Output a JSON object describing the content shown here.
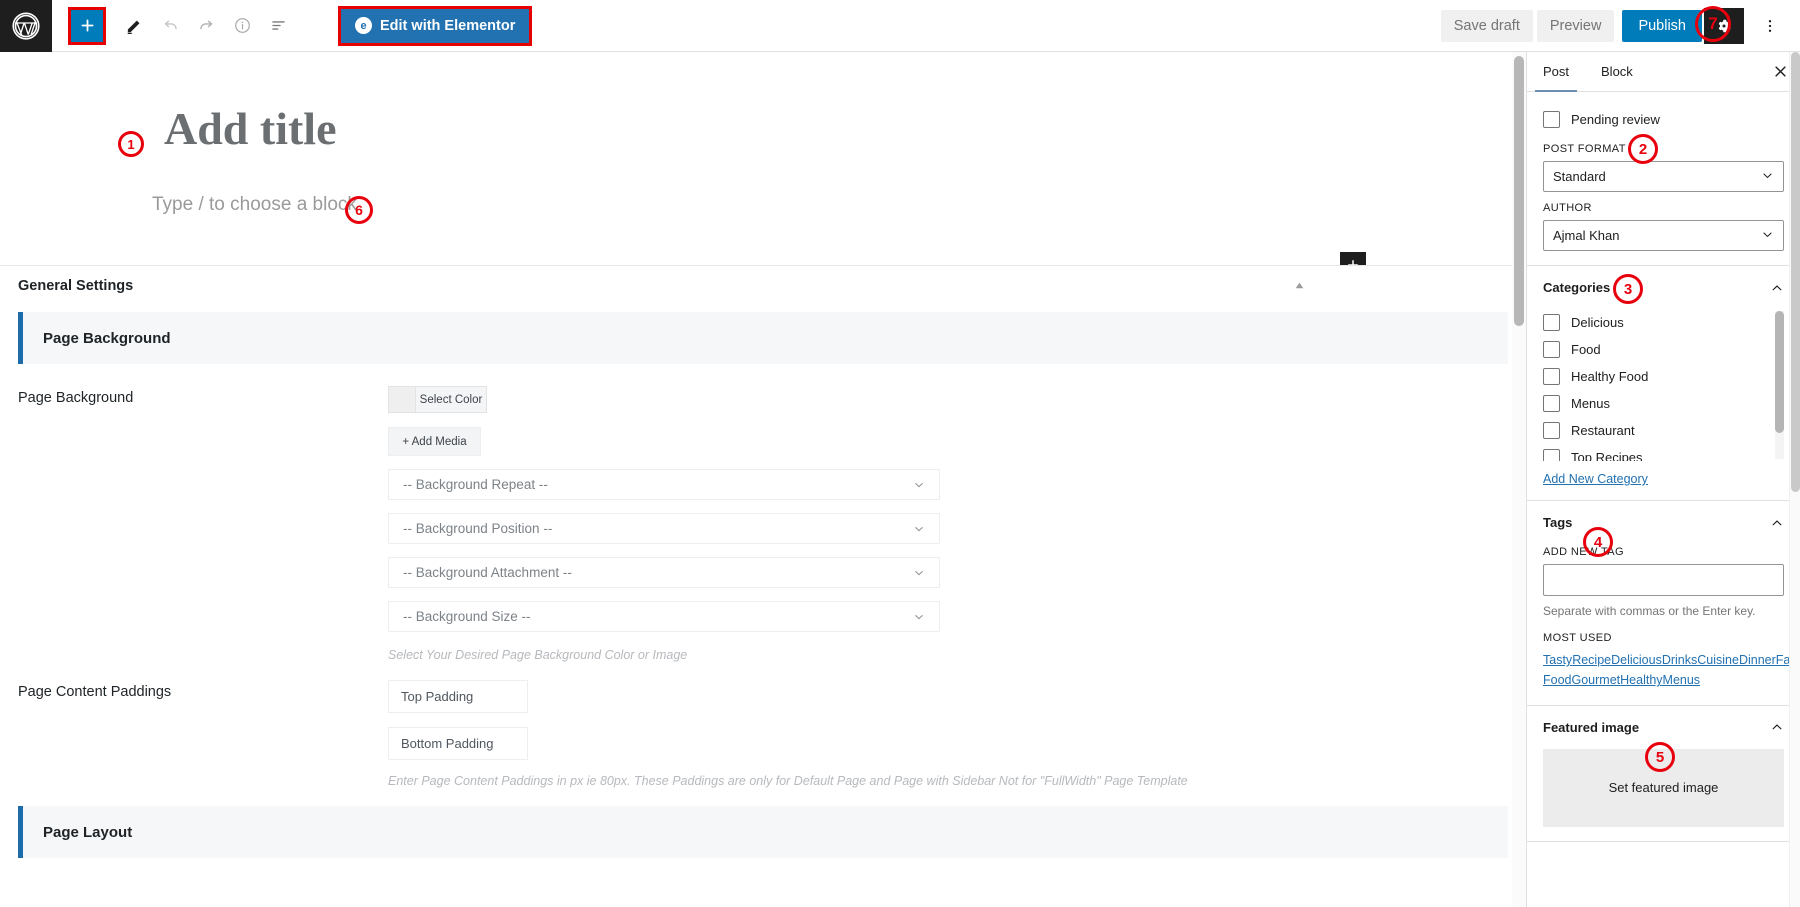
{
  "topbar": {
    "logo_icon": "wordpress-logo-icon",
    "inserter_label": "+",
    "tools": [
      {
        "name": "edit-tool-icon",
        "label": "Edit"
      },
      {
        "name": "undo-icon",
        "label": "Undo"
      },
      {
        "name": "redo-icon",
        "label": "Redo"
      },
      {
        "name": "details-info-icon",
        "label": "Details"
      },
      {
        "name": "list-view-icon",
        "label": "List view"
      }
    ],
    "elementor_button": "Edit with Elementor",
    "elementor_badge": "e",
    "save_draft": "Save draft",
    "preview": "Preview",
    "publish": "Publish",
    "settings_icon": "gear-icon",
    "more_icon": "more-options-icon"
  },
  "editor": {
    "title_placeholder": "Add title",
    "block_placeholder": "Type / to choose a block",
    "inserter_label": "+"
  },
  "metabox": {
    "header_title": "General Settings",
    "sections": {
      "page_background": "Page Background",
      "page_layout": "Page Layout"
    },
    "fields": {
      "page_background_label": "Page Background",
      "select_color": "Select Color",
      "add_media": "+ Add Media",
      "bg_repeat": "-- Background Repeat --",
      "bg_position": "-- Background Position --",
      "bg_attachment": "-- Background Attachment --",
      "bg_size": "-- Background Size --",
      "bg_note": "Select Your Desired Page Background Color or Image",
      "paddings_label": "Page Content Paddings",
      "top_padding_placeholder": "Top Padding",
      "bottom_padding_placeholder": "Bottom Padding",
      "top_padding_value": "",
      "bottom_padding_value": "",
      "paddings_note": "Enter Page Content Paddings in px ie 80px. These Paddings are only for Default Page and Page with Sidebar Not for \"FullWidth\" Page Template"
    }
  },
  "sidebar": {
    "tabs": [
      {
        "label": "Post",
        "active": true
      },
      {
        "label": "Block",
        "active": false
      }
    ],
    "close_icon": "close-icon",
    "status": {
      "pending_review": "Pending review",
      "post_format_label": "POST FORMAT",
      "post_format_value": "Standard",
      "author_label": "AUTHOR",
      "author_value": "Ajmal Khan"
    },
    "categories": {
      "title": "Categories",
      "items": [
        {
          "label": "Delicious",
          "checked": false
        },
        {
          "label": "Food",
          "checked": false
        },
        {
          "label": "Healthy Food",
          "checked": false
        },
        {
          "label": "Menus",
          "checked": false
        },
        {
          "label": "Restaurant",
          "checked": false
        },
        {
          "label": "Top Recipes",
          "checked": false
        }
      ],
      "add_new": "Add New Category"
    },
    "tags": {
      "title": "Tags",
      "add_new_label": "ADD NEW TAG",
      "input_value": "",
      "help": "Separate with commas or the Enter key.",
      "most_used_label": "MOST USED",
      "most_used": [
        "Tasty",
        "Recipe",
        "Delicious",
        "Drinks",
        "Cuisine",
        "Dinner",
        "Fast Food",
        "Gourmet",
        "Healthy",
        "Menus"
      ]
    },
    "featured_image": {
      "title": "Featured image",
      "set_label": "Set featured image"
    }
  },
  "annotations": [
    {
      "id": "1",
      "target": "post-title"
    },
    {
      "id": "2",
      "target": "post-format"
    },
    {
      "id": "3",
      "target": "categories-panel"
    },
    {
      "id": "4",
      "target": "tags-panel"
    },
    {
      "id": "5",
      "target": "featured-image-panel"
    },
    {
      "id": "6",
      "target": "block-placeholder"
    },
    {
      "id": "7",
      "target": "settings-gear"
    }
  ],
  "colors": {
    "wp_blue": "#007cba",
    "elementor_blue": "#2271b1",
    "annotation_red": "#e8000d",
    "section_accent": "#1b6ca8"
  }
}
